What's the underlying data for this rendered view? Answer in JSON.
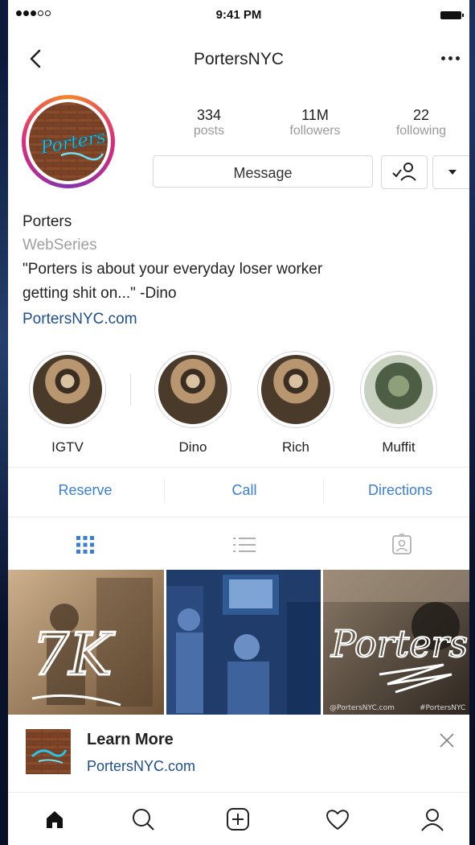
{
  "status_bar": {
    "time": "9:41 PM"
  },
  "nav": {
    "title": "PortersNYC"
  },
  "avatar": {
    "logo_text": "Porters"
  },
  "stats": [
    {
      "value": "334",
      "label": "posts"
    },
    {
      "value": "11M",
      "label": "followers"
    },
    {
      "value": "22",
      "label": "following"
    }
  ],
  "profile_actions": {
    "message_label": "Message"
  },
  "bio": {
    "name": "Porters",
    "category": "WebSeries",
    "text": "\"Porters is about your everyday loser worker\ngetting shit on...\"  -Dino",
    "link": "PortersNYC.com"
  },
  "highlights": [
    {
      "label": "IGTV"
    },
    {
      "label": "Dino"
    },
    {
      "label": "Rich"
    },
    {
      "label": "Muffit"
    }
  ],
  "contact_actions": [
    {
      "label": "Reserve"
    },
    {
      "label": "Call"
    },
    {
      "label": "Directions"
    }
  ],
  "grid": [
    {
      "overlay_text": "7K"
    },
    {
      "overlay_text": ""
    },
    {
      "overlay_text": "Porters",
      "caption_left": "@PortersNYC.com",
      "caption_right": "#PortersNYC"
    }
  ],
  "promo": {
    "title": "Learn More",
    "link": "PortersNYC.com"
  },
  "colors": {
    "link": "#1f4e8c",
    "action": "#3b7fd4",
    "tab_active": "#3b7fd4"
  },
  "icons": {
    "tabs": [
      "grid-icon",
      "list-icon",
      "tagged-icon"
    ],
    "bottom_bar": [
      "home-icon",
      "search-icon",
      "add-post-icon",
      "heart-icon",
      "profile-icon"
    ]
  }
}
